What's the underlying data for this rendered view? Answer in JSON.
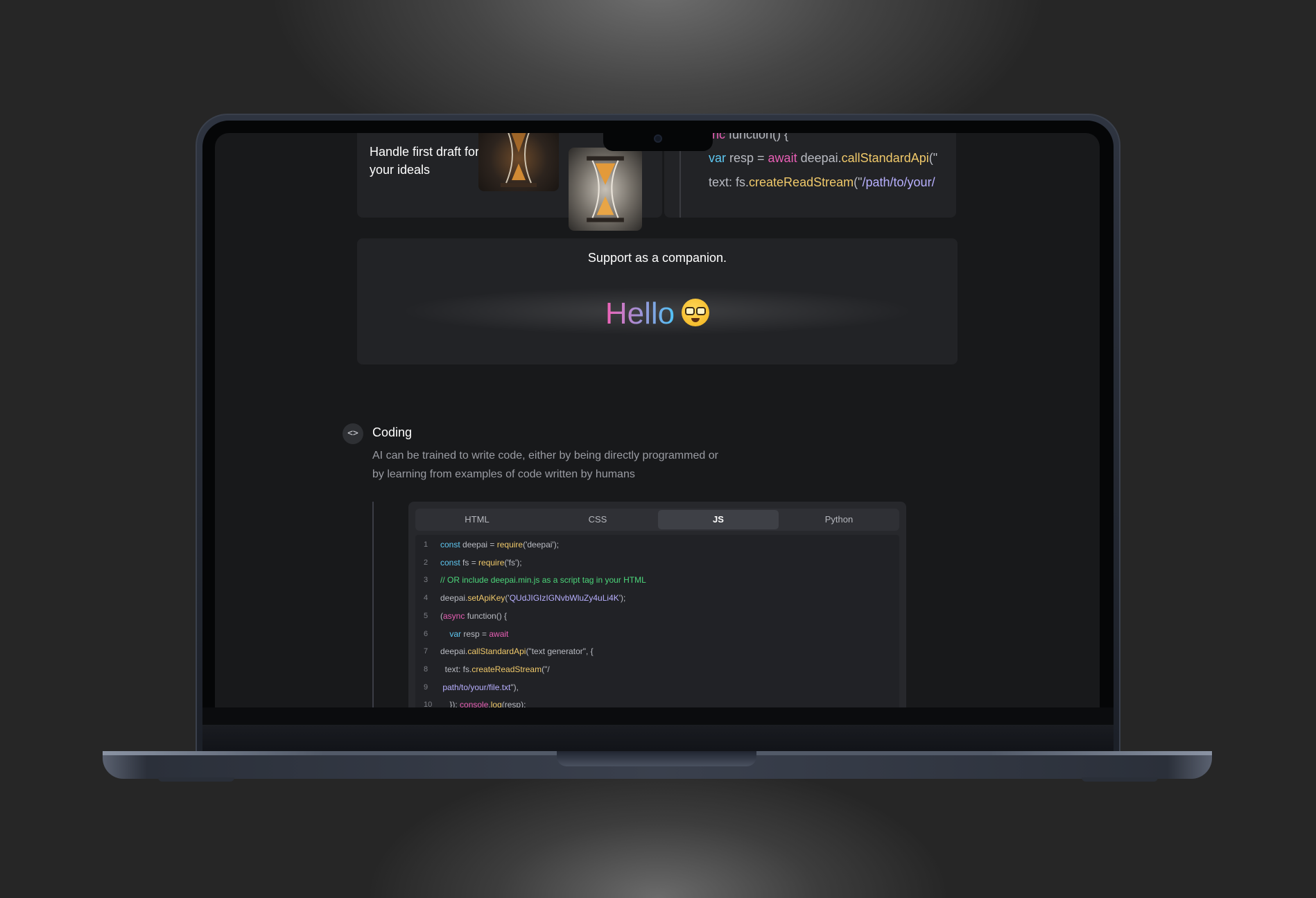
{
  "draft_card": {
    "title": "Handle first draft for your ideals"
  },
  "code_preview": {
    "lines": [
      {
        "parts": [
          {
            "t": "(async",
            "cls": "kw"
          },
          {
            "t": " function() {",
            "cls": ""
          }
        ]
      },
      {
        "parts": [
          {
            "t": "var",
            "cls": "id"
          },
          {
            "t": " resp = ",
            "cls": ""
          },
          {
            "t": "await",
            "cls": "kw"
          },
          {
            "t": " deepai.",
            "cls": ""
          },
          {
            "t": "callStandardApi",
            "cls": "fn"
          },
          {
            "t": "(\"",
            "cls": ""
          }
        ]
      },
      {
        "parts": [
          {
            "t": "text: fs.",
            "cls": ""
          },
          {
            "t": "createReadStream",
            "cls": "fn"
          },
          {
            "t": "(\"",
            "cls": ""
          },
          {
            "t": "/path/to/your/",
            "cls": "st"
          }
        ]
      }
    ]
  },
  "companion": {
    "title": "Support as a companion.",
    "greeting": "Hello",
    "emoji": "nerd-face-emoji"
  },
  "coding": {
    "title": "Coding",
    "description": "AI can be trained to write code, either by being directly programmed or by learning from examples of code written by humans",
    "tabs": [
      "HTML",
      "CSS",
      "JS",
      "Python"
    ],
    "active_tab": "JS",
    "code": [
      {
        "n": "1",
        "parts": [
          {
            "t": "const",
            "cls": "id"
          },
          {
            "t": " deepai = ",
            "cls": ""
          },
          {
            "t": "require",
            "cls": "fn"
          },
          {
            "t": "('deepai');",
            "cls": ""
          }
        ]
      },
      {
        "n": "2",
        "parts": [
          {
            "t": "const",
            "cls": "id"
          },
          {
            "t": " fs = ",
            "cls": ""
          },
          {
            "t": "require",
            "cls": "fn"
          },
          {
            "t": "('fs');",
            "cls": ""
          }
        ]
      },
      {
        "n": "3",
        "parts": [
          {
            "t": "// OR include deepai.min.js as a script tag in your HTML",
            "cls": "cm"
          }
        ]
      },
      {
        "n": "4",
        "parts": [
          {
            "t": "deepai.",
            "cls": ""
          },
          {
            "t": "setApiKey",
            "cls": "fn"
          },
          {
            "t": "('",
            "cls": ""
          },
          {
            "t": "QUdJIGIzIGNvbWluZy4uLi4K",
            "cls": "st"
          },
          {
            "t": "');",
            "cls": ""
          }
        ]
      },
      {
        "n": "5",
        "parts": [
          {
            "t": "(",
            "cls": ""
          },
          {
            "t": "async",
            "cls": "kw"
          },
          {
            "t": " function() {",
            "cls": ""
          }
        ]
      },
      {
        "n": "6",
        "parts": [
          {
            "t": "    var",
            "cls": "id"
          },
          {
            "t": " resp = ",
            "cls": ""
          },
          {
            "t": "await",
            "cls": "kw"
          }
        ]
      },
      {
        "n": "7",
        "parts": [
          {
            "t": "deepai.",
            "cls": ""
          },
          {
            "t": "callStandardApi",
            "cls": "fn"
          },
          {
            "t": "(\"text generator\", {",
            "cls": ""
          }
        ]
      },
      {
        "n": "8",
        "parts": [
          {
            "t": "  text: fs.",
            "cls": ""
          },
          {
            "t": "createReadStream",
            "cls": "fn"
          },
          {
            "t": "(\"/",
            "cls": ""
          }
        ]
      },
      {
        "n": "9",
        "parts": [
          {
            "t": " path/to/your/file.txt",
            "cls": "st"
          },
          {
            "t": "\"),",
            "cls": ""
          }
        ]
      },
      {
        "n": "10",
        "parts": [
          {
            "t": "    }); ",
            "cls": ""
          },
          {
            "t": "console",
            "cls": "kw"
          },
          {
            "t": ".",
            "cls": ""
          },
          {
            "t": "log",
            "cls": "fn"
          },
          {
            "t": "(resp);",
            "cls": ""
          }
        ]
      }
    ]
  }
}
